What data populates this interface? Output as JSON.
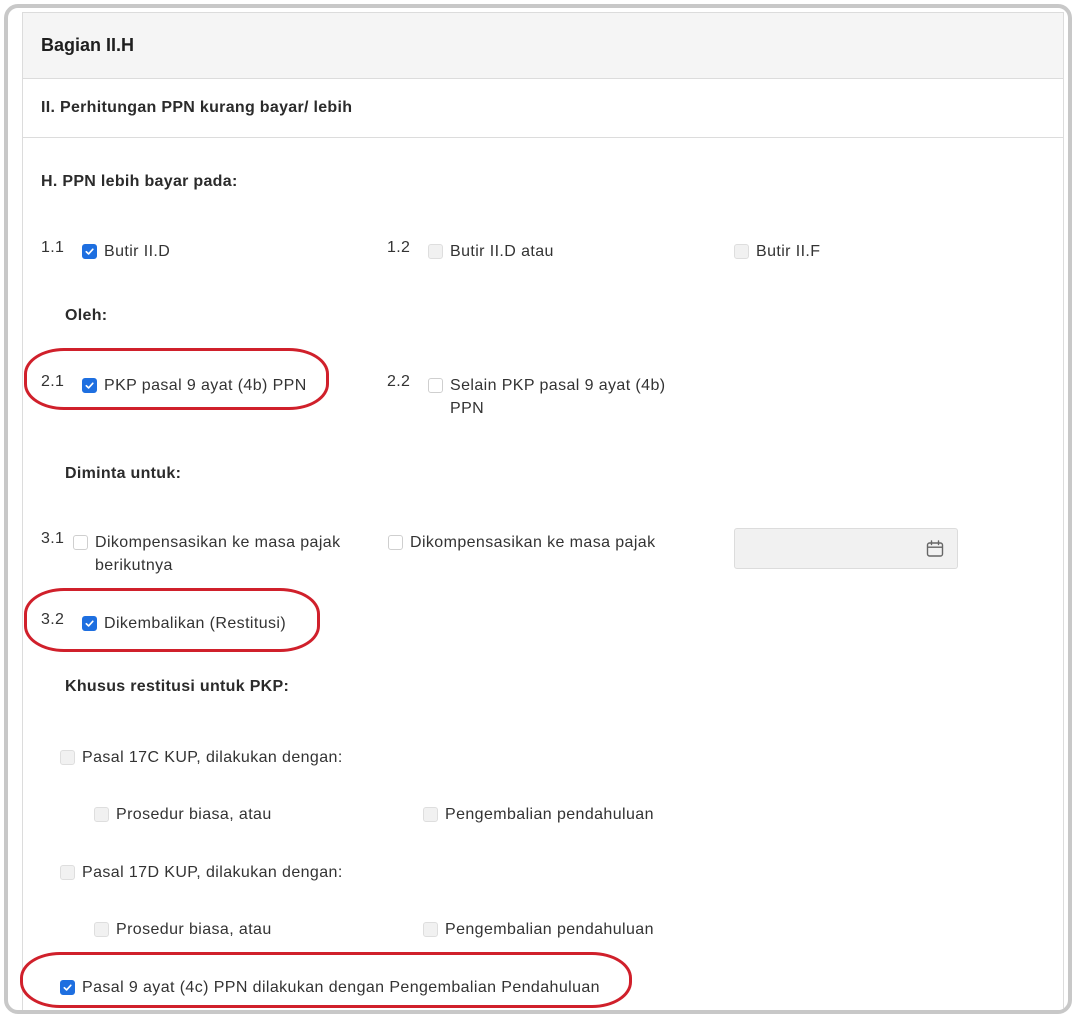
{
  "card": {
    "title": "Bagian II.H",
    "subtitle": "II. Perhitungan PPN kurang bayar/ lebih"
  },
  "section_h": {
    "heading": "H. PPN lebih bayar pada:",
    "row1": {
      "num_a": "1.1",
      "opt_a": {
        "label": "Butir II.D",
        "checked": true
      },
      "num_b": "1.2",
      "opt_b": {
        "label": "Butir II.D atau",
        "checked": false,
        "disabled": true
      },
      "opt_c": {
        "label": "Butir II.F",
        "checked": false,
        "disabled": true
      }
    },
    "oleh_heading": "Oleh:",
    "row2": {
      "num_a": "2.1",
      "opt_a": {
        "label": "PKP pasal 9 ayat (4b) PPN",
        "checked": true
      },
      "num_b": "2.2",
      "opt_b": {
        "label_line1": "Selain PKP pasal 9 ayat (4b)",
        "label_line2": "PPN",
        "checked": false
      }
    },
    "diminta_heading": "Diminta untuk:",
    "row3": {
      "num_a": "3.1",
      "opt_a": {
        "label_line1": "Dikompensasikan ke masa pajak",
        "label_line2": "berikutnya",
        "checked": false
      },
      "opt_b": {
        "label": "Dikompensasikan ke masa pajak",
        "checked": false
      },
      "date_value": ""
    },
    "row32": {
      "num": "3.2",
      "opt": {
        "label": "Dikembalikan (Restitusi)",
        "checked": true
      }
    },
    "khusus_heading": "Khusus restitusi untuk PKP:",
    "pasal17c": {
      "label": "Pasal 17C KUP, dilakukan dengan:",
      "sub_a": "Prosedur biasa, atau",
      "sub_b": "Pengembalian pendahuluan"
    },
    "pasal17d": {
      "label": "Pasal 17D KUP, dilakukan dengan:",
      "sub_a": "Prosedur biasa, atau",
      "sub_b": "Pengembalian pendahuluan"
    },
    "pasal9": {
      "label": "Pasal 9 ayat (4c) PPN dilakukan dengan Pengembalian Pendahuluan",
      "checked": true
    }
  },
  "colors": {
    "accent": "#1e6fe0",
    "highlight": "#d0202b"
  },
  "icons": {
    "date": "calendar-icon",
    "check": "checkmark-icon"
  }
}
